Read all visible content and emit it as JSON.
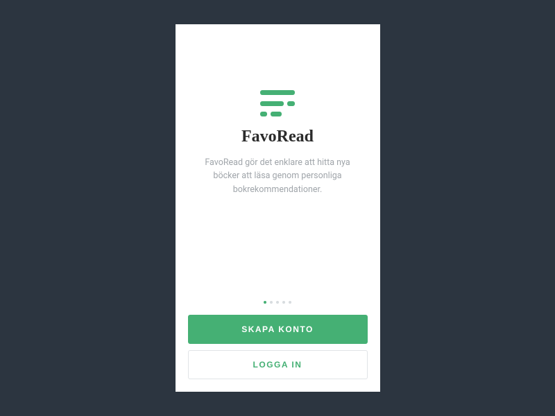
{
  "app": {
    "title": "FavoRead",
    "description": "FavoRead gör det enklare att hitta nya böcker att läsa genom personliga bokrekommendationer."
  },
  "pagination": {
    "total": 5,
    "active_index": 0
  },
  "buttons": {
    "create_account": "SKAPA KONTO",
    "login": "LOGGA IN"
  },
  "colors": {
    "accent": "#45b074",
    "background": "#2c3540"
  }
}
